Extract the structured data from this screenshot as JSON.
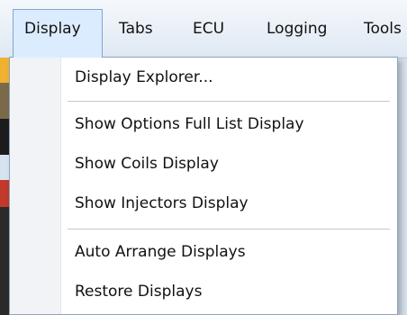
{
  "menubar": {
    "items": [
      {
        "label": "Display"
      },
      {
        "label": "Tabs"
      },
      {
        "label": "ECU"
      },
      {
        "label": "Logging"
      },
      {
        "label": "Tools"
      }
    ]
  },
  "display_menu": {
    "items": [
      {
        "label": "Display Explorer..."
      },
      {
        "label": "Show Options Full List Display"
      },
      {
        "label": "Show Coils Display"
      },
      {
        "label": "Show Injectors Display"
      },
      {
        "label": "Auto Arrange Displays"
      },
      {
        "label": "Restore Displays"
      }
    ]
  },
  "colors": {
    "active_menu_bg": "#dcecff",
    "active_menu_border": "#7fa6d4",
    "dropdown_bg": "#ffffff",
    "gutter_bg": "#f1f3f6"
  }
}
